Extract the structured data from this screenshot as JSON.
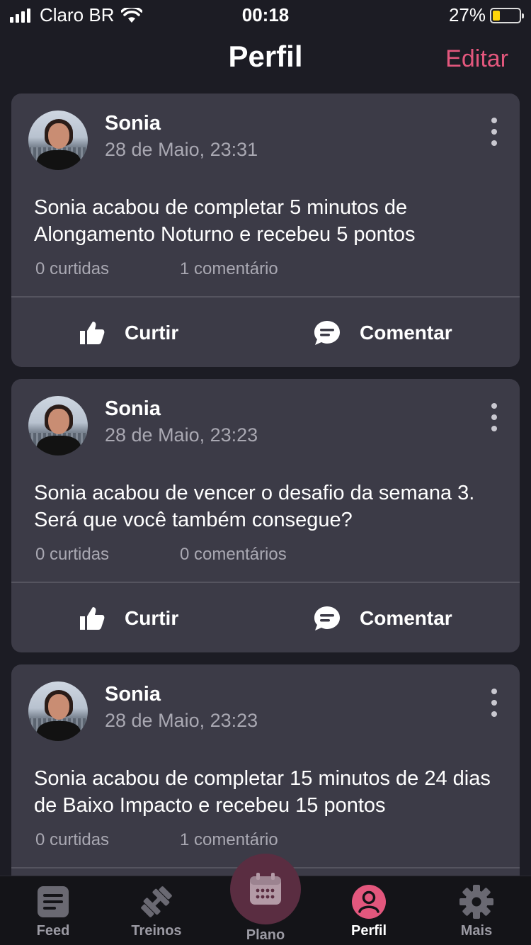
{
  "status_bar": {
    "carrier": "Claro BR",
    "time": "00:18",
    "battery": "27%",
    "battery_level": 0.27
  },
  "header": {
    "title": "Perfil",
    "edit_label": "Editar"
  },
  "accent_color": "#e3577d",
  "posts": [
    {
      "author": "Sonia",
      "time": "28 de Maio, 23:31",
      "text": "Sonia acabou de completar 5 minutos de Alongamento Noturno e recebeu 5 pontos",
      "likes": "0 curtidas",
      "comments": "1 comentário",
      "like_label": "Curtir",
      "comment_label": "Comentar"
    },
    {
      "author": "Sonia",
      "time": "28 de Maio, 23:23",
      "text": "Sonia acabou de vencer o desafio da semana 3. Será que você também consegue?",
      "likes": "0 curtidas",
      "comments": "0 comentários",
      "like_label": "Curtir",
      "comment_label": "Comentar"
    },
    {
      "author": "Sonia",
      "time": "28 de Maio, 23:23",
      "text": "Sonia acabou de completar 15 minutos de 24 dias de Baixo Impacto e recebeu 15 pontos",
      "likes": "0 curtidas",
      "comments": "1 comentário",
      "like_label": "Curtir",
      "comment_label": "Comentar"
    }
  ],
  "bottom_nav": {
    "items": [
      {
        "label": "Feed",
        "icon": "feed-icon"
      },
      {
        "label": "Treinos",
        "icon": "dumbbell-icon"
      },
      {
        "label": "Plano",
        "icon": "calendar-icon"
      },
      {
        "label": "Perfil",
        "icon": "profile-icon",
        "active": true
      },
      {
        "label": "Mais",
        "icon": "gear-icon"
      }
    ]
  }
}
